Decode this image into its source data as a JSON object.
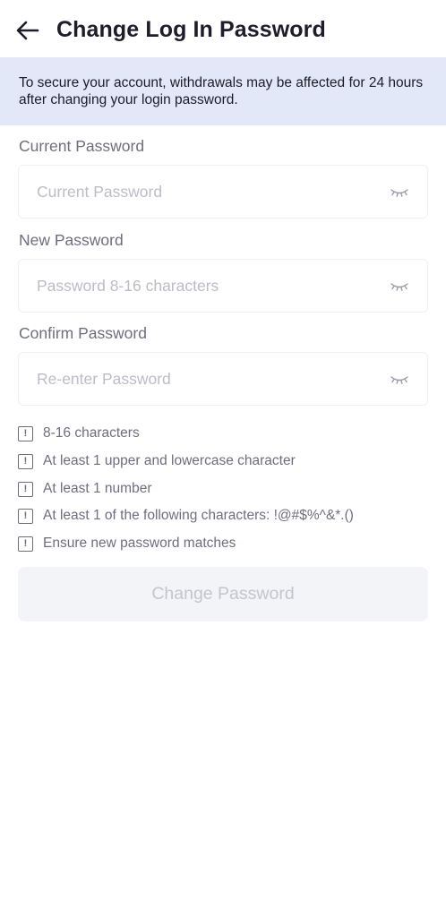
{
  "header": {
    "title": "Change Log In Password"
  },
  "notice": {
    "text": "To secure your account, withdrawals may be affected for 24 hours after changing your login password."
  },
  "form": {
    "current": {
      "label": "Current Password",
      "placeholder": "Current Password",
      "value": ""
    },
    "new": {
      "label": "New Password",
      "placeholder": "Password 8-16 characters",
      "value": ""
    },
    "confirm": {
      "label": "Confirm Password",
      "placeholder": "Re-enter Password",
      "value": ""
    }
  },
  "requirements": [
    {
      "icon": "!",
      "text": "8-16 characters",
      "met": false
    },
    {
      "icon": "!",
      "text": "At least 1 upper and lowercase character",
      "met": false
    },
    {
      "icon": "!",
      "text": "At least 1 number",
      "met": false
    },
    {
      "icon": "!",
      "text": "At least 1 of the following characters: !@#$%^&*.()",
      "met": false
    },
    {
      "icon": "!",
      "text": "Ensure new password matches",
      "met": false
    }
  ],
  "submit": {
    "label": "Change Password",
    "enabled": false
  },
  "icons": {
    "back": "arrow-left-icon",
    "visibility": "eye-closed-icon",
    "requirement": "exclamation-box-icon"
  },
  "colors": {
    "notice_background": "#e3e8f8",
    "label_text": "#6e6e7e",
    "placeholder_text": "#bcbcc6",
    "disabled_button_bg": "#f3f4f7",
    "disabled_button_text": "#c4c5cc"
  }
}
